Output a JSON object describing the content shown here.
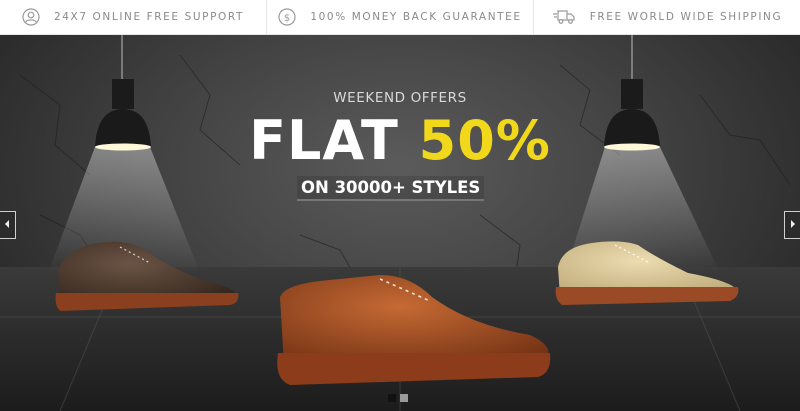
{
  "topbar": {
    "items": [
      {
        "label": "24X7 ONLINE FREE SUPPORT",
        "icon": "user-circle-icon"
      },
      {
        "label": "100% MONEY BACK GUARANTEE",
        "icon": "dollar-coin-icon"
      },
      {
        "label": "FREE WORLD WIDE SHIPPING",
        "icon": "delivery-truck-icon"
      }
    ]
  },
  "hero": {
    "kicker": "WEEKEND OFFERS",
    "headline_main": "FLAT ",
    "headline_highlight": "50%",
    "subline": "ON 30000+ STYLES",
    "colors": {
      "highlight": "#f2d81a",
      "text": "#ffffff",
      "background": "#3a3a3a"
    },
    "products": [
      {
        "name": "dark-brown-derby-shoe",
        "color": "#4a3526"
      },
      {
        "name": "tan-leather-derby-shoe",
        "color": "#9c4a22"
      },
      {
        "name": "beige-suede-derby-shoe",
        "color": "#d8c595"
      }
    ]
  },
  "slider": {
    "prev_icon": "chevron-left-icon",
    "next_icon": "chevron-right-icon",
    "slide_count": 2,
    "active_slide": 1
  }
}
